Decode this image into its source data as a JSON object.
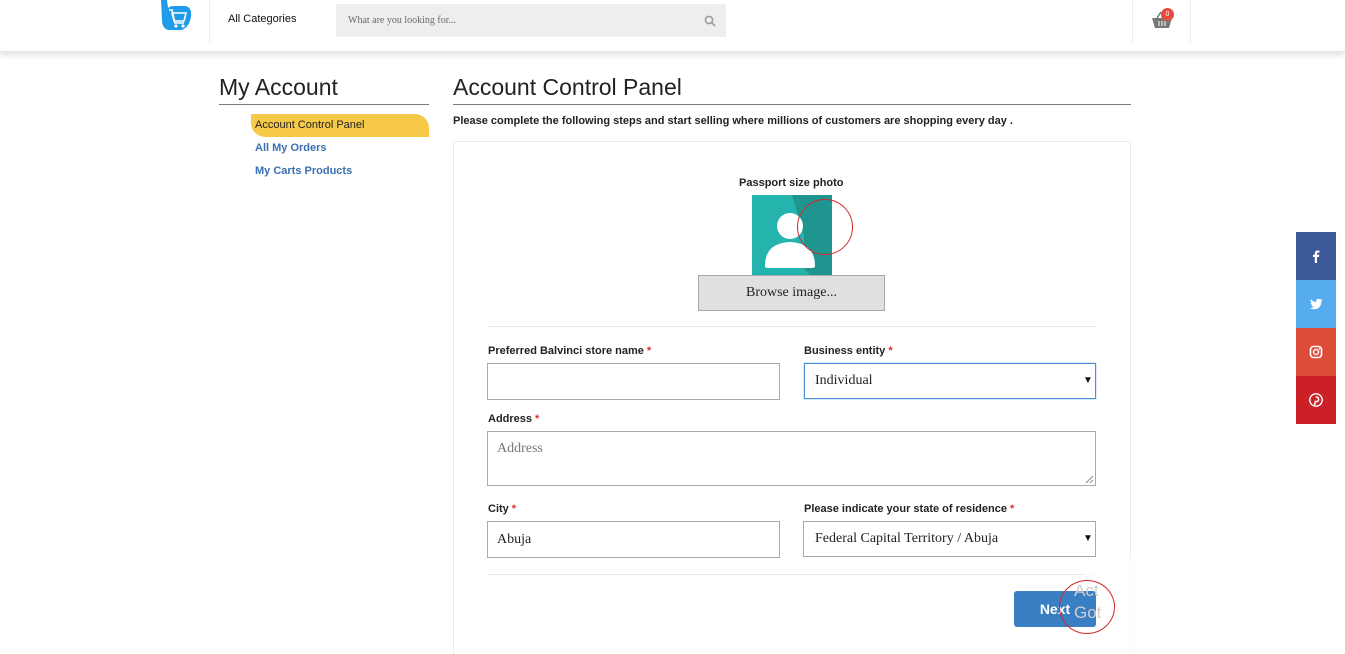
{
  "header": {
    "logo": "balvinci-cart-logo",
    "categories_label": "All Categories",
    "search_placeholder": "What are you looking for...",
    "cart_count": "0"
  },
  "sidebar": {
    "title": "My Account",
    "items": [
      {
        "label": "Account Control Panel",
        "active": true
      },
      {
        "label": "All My Orders",
        "active": false
      },
      {
        "label": "My Carts Products",
        "active": false
      }
    ]
  },
  "main": {
    "title": "Account Control Panel",
    "subtitle": "Please complete the following steps and start selling where millions of customers are shopping every day .",
    "photo_label": "Passport size photo",
    "browse_label": "Browse image...",
    "form": {
      "store_name_label": "Preferred Balvinci store name",
      "store_name_value": "",
      "entity_label": "Business entity",
      "entity_value": "Individual",
      "address_label": "Address",
      "address_placeholder": "Address",
      "city_label": "City",
      "city_value": "Abuja",
      "state_label": "Please indicate your state of residence",
      "state_value": "Federal Capital Territory / Abuja",
      "required_mark": "*"
    },
    "next_label": "Next"
  },
  "watermark": {
    "line1": "Act",
    "line2": "Got"
  },
  "social": [
    {
      "name": "facebook",
      "color": "#3b5998"
    },
    {
      "name": "twitter",
      "color": "#55acee"
    },
    {
      "name": "instagram",
      "color": "#dd4b39"
    },
    {
      "name": "pinterest",
      "color": "#cb2027"
    }
  ],
  "colors": {
    "accent": "#f7c948",
    "link": "#3a70b0",
    "primary_button": "#3a7fc3"
  }
}
